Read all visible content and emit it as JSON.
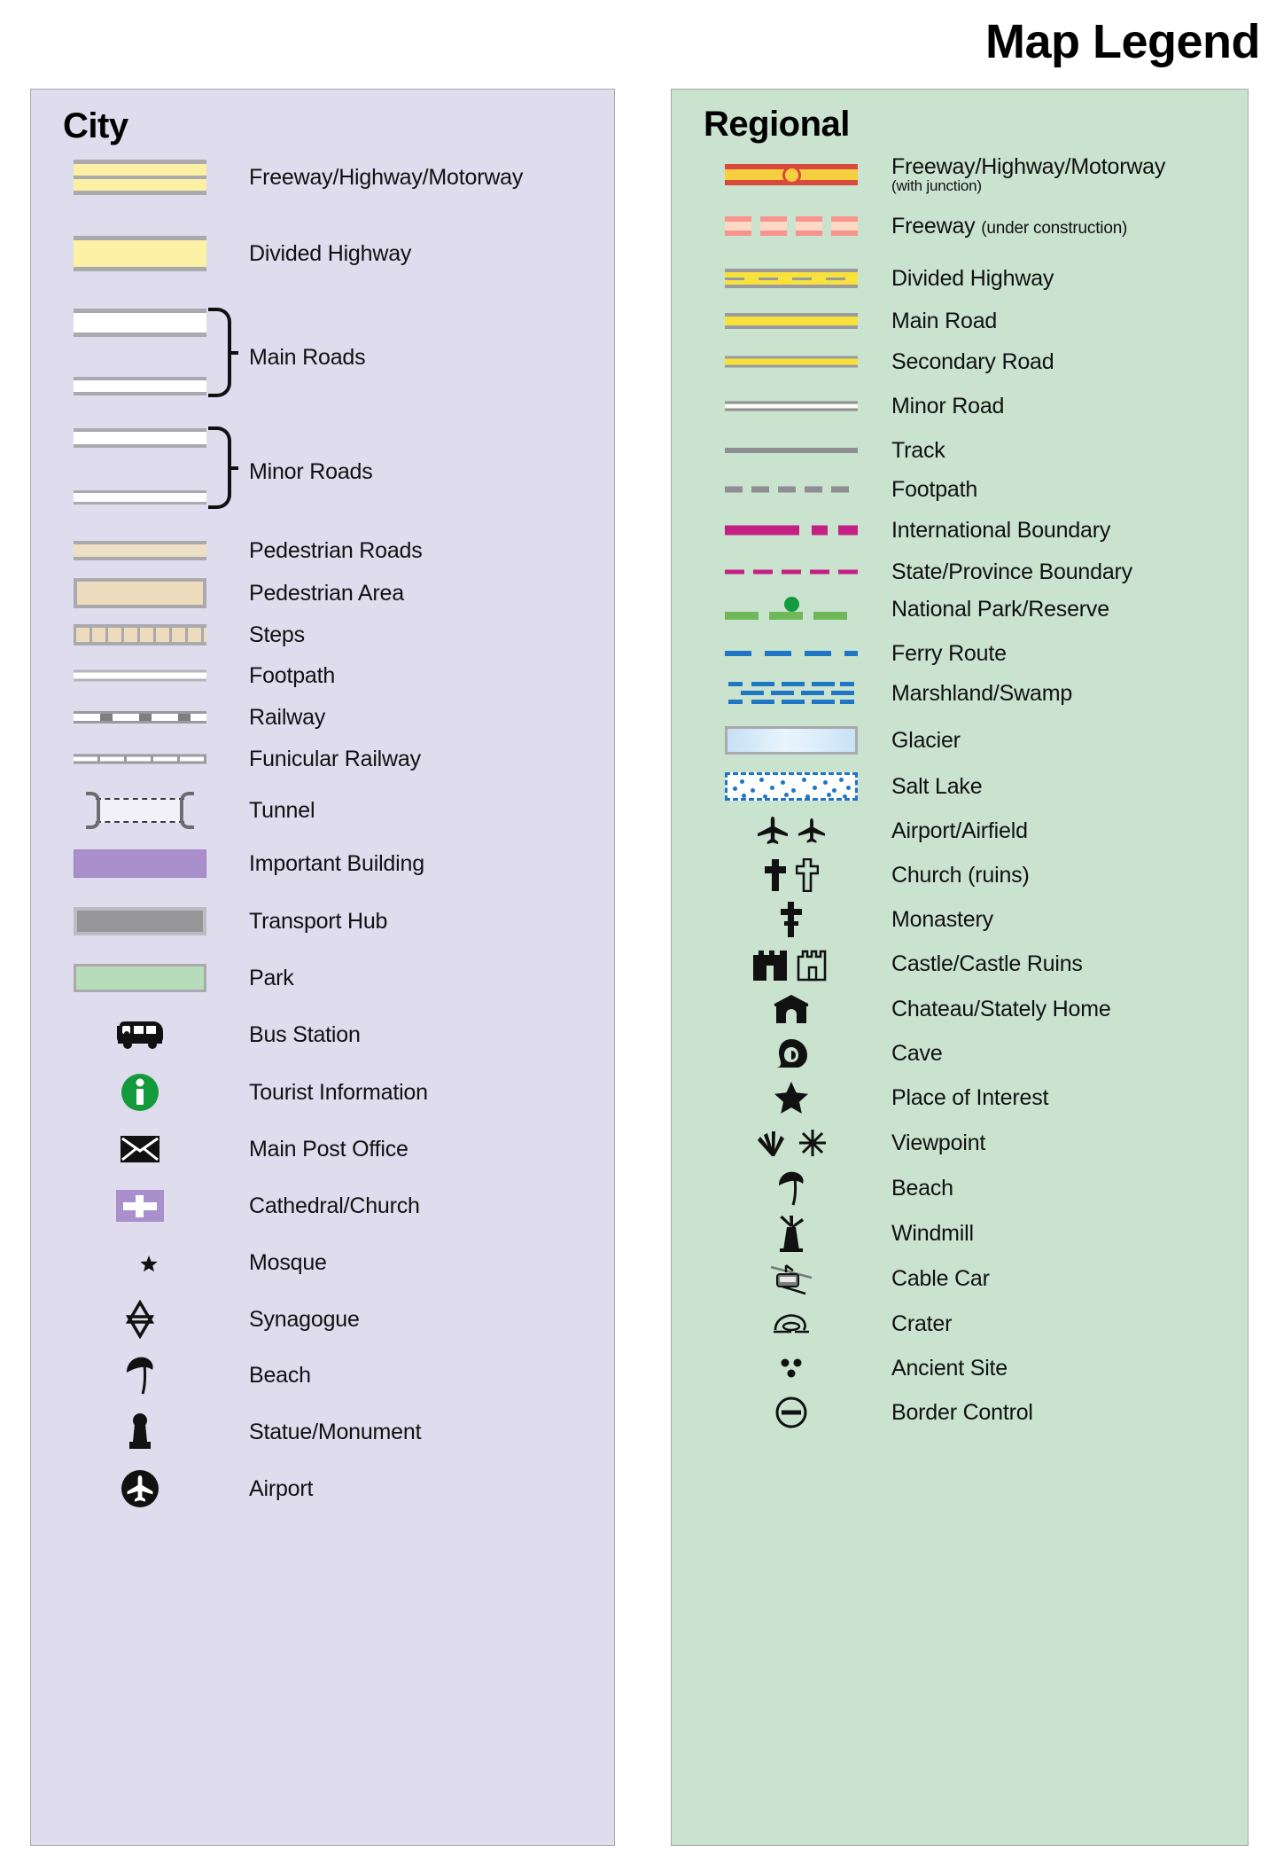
{
  "title": "Map Legend",
  "city": {
    "heading": "City",
    "items": [
      {
        "label": "Freeway/Highway/Motorway",
        "symbol": "city-freeway"
      },
      {
        "label": "Divided Highway",
        "symbol": "city-divided-highway"
      },
      {
        "label": "Main Roads",
        "symbol": "city-main-roads-bracket"
      },
      {
        "label": "Minor Roads",
        "symbol": "city-minor-roads-bracket"
      },
      {
        "label": "Pedestrian Roads",
        "symbol": "city-pedestrian-road"
      },
      {
        "label": "Pedestrian Area",
        "symbol": "city-pedestrian-area"
      },
      {
        "label": "Steps",
        "symbol": "city-steps"
      },
      {
        "label": "Footpath",
        "symbol": "city-footpath"
      },
      {
        "label": "Railway",
        "symbol": "city-railway"
      },
      {
        "label": "Funicular Railway",
        "symbol": "city-funicular-railway"
      },
      {
        "label": "Tunnel",
        "symbol": "city-tunnel"
      },
      {
        "label": "Important Building",
        "symbol": "city-important-building"
      },
      {
        "label": "Transport Hub",
        "symbol": "city-transport-hub"
      },
      {
        "label": "Park",
        "symbol": "city-park"
      },
      {
        "label": "Bus Station",
        "symbol": "bus-icon"
      },
      {
        "label": "Tourist Information",
        "symbol": "info-icon"
      },
      {
        "label": "Main Post Office",
        "symbol": "envelope-icon"
      },
      {
        "label": "Cathedral/Church",
        "symbol": "church-cross-icon"
      },
      {
        "label": "Mosque",
        "symbol": "crescent-star-icon"
      },
      {
        "label": "Synagogue",
        "symbol": "star-of-david-icon"
      },
      {
        "label": "Beach",
        "symbol": "beach-umbrella-icon"
      },
      {
        "label": "Statue/Monument",
        "symbol": "statue-icon"
      },
      {
        "label": "Airport",
        "symbol": "airport-circle-icon"
      }
    ]
  },
  "regional": {
    "heading": "Regional",
    "items": [
      {
        "label": "Freeway/Highway/Motorway",
        "sub": "(with junction)",
        "symbol": "regional-freeway-junction"
      },
      {
        "label": "Freeway",
        "inline_sub": "(under construction)",
        "symbol": "regional-freeway-under-construction"
      },
      {
        "label": "Divided Highway",
        "symbol": "regional-divided-highway"
      },
      {
        "label": "Main Road",
        "symbol": "regional-main-road"
      },
      {
        "label": "Secondary Road",
        "symbol": "regional-secondary-road"
      },
      {
        "label": "Minor Road",
        "symbol": "regional-minor-road"
      },
      {
        "label": "Track",
        "symbol": "regional-track"
      },
      {
        "label": "Footpath",
        "symbol": "regional-footpath"
      },
      {
        "label": "International Boundary",
        "symbol": "regional-international-boundary"
      },
      {
        "label": "State/Province Boundary",
        "symbol": "regional-state-boundary"
      },
      {
        "label": "National Park/Reserve",
        "symbol": "regional-national-park"
      },
      {
        "label": "Ferry Route",
        "symbol": "regional-ferry-route"
      },
      {
        "label": "Marshland/Swamp",
        "symbol": "regional-marshland"
      },
      {
        "label": "Glacier",
        "symbol": "regional-glacier"
      },
      {
        "label": "Salt Lake",
        "symbol": "regional-salt-lake"
      },
      {
        "label": "Airport/Airfield",
        "symbol": "airplane-icons"
      },
      {
        "label": "Church (ruins)",
        "symbol": "church-ruins-icons"
      },
      {
        "label": "Monastery",
        "symbol": "monastery-cross-icon"
      },
      {
        "label": "Castle/Castle Ruins",
        "symbol": "castle-icons"
      },
      {
        "label": "Chateau/Stately Home",
        "symbol": "chateau-icon"
      },
      {
        "label": "Cave",
        "symbol": "cave-icon"
      },
      {
        "label": "Place of Interest",
        "symbol": "star-icon"
      },
      {
        "label": "Viewpoint",
        "symbol": "viewpoint-icons"
      },
      {
        "label": "Beach",
        "symbol": "beach-umbrella-icon"
      },
      {
        "label": "Windmill",
        "symbol": "windmill-icon"
      },
      {
        "label": "Cable Car",
        "symbol": "cable-car-icon"
      },
      {
        "label": "Crater",
        "symbol": "crater-icon"
      },
      {
        "label": "Ancient Site",
        "symbol": "ancient-site-icon"
      },
      {
        "label": "Border Control",
        "symbol": "border-control-icon"
      }
    ]
  },
  "colors": {
    "city_panel_bg": "#dedced",
    "regional_panel_bg": "#c9e3cf",
    "highway_yellow": "#fbf0a3",
    "regional_road_yellow": "#f7e23c",
    "freeway_red": "#d94a3d",
    "boundary_magenta": "#c42083",
    "water_blue": "#1f76c4",
    "park_green": "#6fb758",
    "building_purple": "#a98fcc",
    "info_green": "#139a3c",
    "casing_gray": "#9a9a9f",
    "pedestrian_tan": "#ecdcbd"
  }
}
